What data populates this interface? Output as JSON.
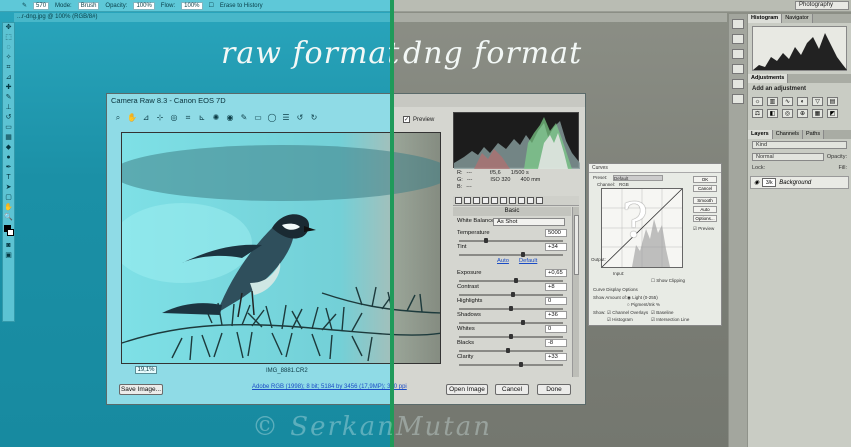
{
  "options_bar": {
    "size": "570",
    "mode_label": "Mode:",
    "mode_value": "Brush",
    "opacity_label": "Opacity:",
    "opacity_value": "100%",
    "flow_label": "Flow:",
    "flow_value": "100%",
    "erase_label": "Erase to History",
    "workspace": "Photography"
  },
  "document_tab": "...r-dng.jpg @ 100% (RGB/8#)",
  "headings": {
    "left": "raw format",
    "right": "dng format"
  },
  "camera_raw": {
    "title": "Camera Raw 8.3  -  Canon EOS 7D",
    "preview_label": "Preview",
    "zoom": "19,1%",
    "filename": "IMG_8881.CR2",
    "save_button": "Save Image...",
    "workflow_link": "Adobe RGB (1998); 8 bit; 5184 by 3456 (17,9MP); 300 ppi",
    "open_button": "Open Image",
    "cancel_button": "Cancel",
    "done_button": "Done",
    "info": {
      "r": "R:",
      "g": "G:",
      "b": "B:",
      "r_val": "---",
      "g_val": "---",
      "b_val": "---",
      "aperture": "f/5,6",
      "shutter": "1/500 s",
      "iso": "ISO 320",
      "focal": "400 mm"
    },
    "panel_title": "Basic",
    "white_balance_label": "White Balance:",
    "white_balance_value": "As Shot",
    "auto_link": "Auto",
    "default_link": "Default",
    "sliders": [
      {
        "label": "Temperature",
        "value": "5000",
        "pos": 0.25
      },
      {
        "label": "Tint",
        "value": "+34",
        "pos": 0.62
      },
      {
        "label": "Exposure",
        "value": "+0,65",
        "pos": 0.55
      },
      {
        "label": "Contrast",
        "value": "+8",
        "pos": 0.52
      },
      {
        "label": "Highlights",
        "value": "0",
        "pos": 0.5
      },
      {
        "label": "Shadows",
        "value": "+36",
        "pos": 0.62
      },
      {
        "label": "Whites",
        "value": "0",
        "pos": 0.5
      },
      {
        "label": "Blacks",
        "value": "-8",
        "pos": 0.47
      },
      {
        "label": "Clarity",
        "value": "+33",
        "pos": 0.6
      }
    ]
  },
  "panels": {
    "histogram_tab": "Histogram",
    "navigator_tab": "Navigator",
    "adjustments_tab": "Adjustments",
    "adjustments_title": "Add an adjustment",
    "layers_tab": "Layers",
    "channels_tab": "Channels",
    "paths_tab": "Paths",
    "kind": "Kind",
    "blend_mode": "Normal",
    "opacity_label": "Opacity:",
    "fill_label": "Fill:",
    "lock_label": "Lock:",
    "layer_name": "Background",
    "layer_thumb_text": "3/k"
  },
  "curves": {
    "title": "Curves",
    "preset_label": "Preset:",
    "preset_value": "Default",
    "channel_label": "Channel:",
    "channel_value": "RGB",
    "buttons": [
      "OK",
      "Cancel",
      "Smooth",
      "Auto",
      "Options..."
    ],
    "preview_label": "Preview",
    "output_label": "Output:",
    "input_label": "Input:",
    "show_clipping": "Show Clipping",
    "curve_display": "Curve Display Options",
    "show_amount": "Show Amount of:",
    "light": "Light (0-255)",
    "pigment": "Pigment/Ink %",
    "show_label": "Show:",
    "channel_overlays": "Channel Overlays",
    "baseline": "Baseline",
    "histogram": "Histogram",
    "intersection": "Intersection Line",
    "question_mark": "?"
  },
  "signature": "© SerkanMutan",
  "colors": {
    "teal_bg": "#1b90a6",
    "gray_bg": "#7a7d75",
    "divider": "#1f9a5a"
  }
}
